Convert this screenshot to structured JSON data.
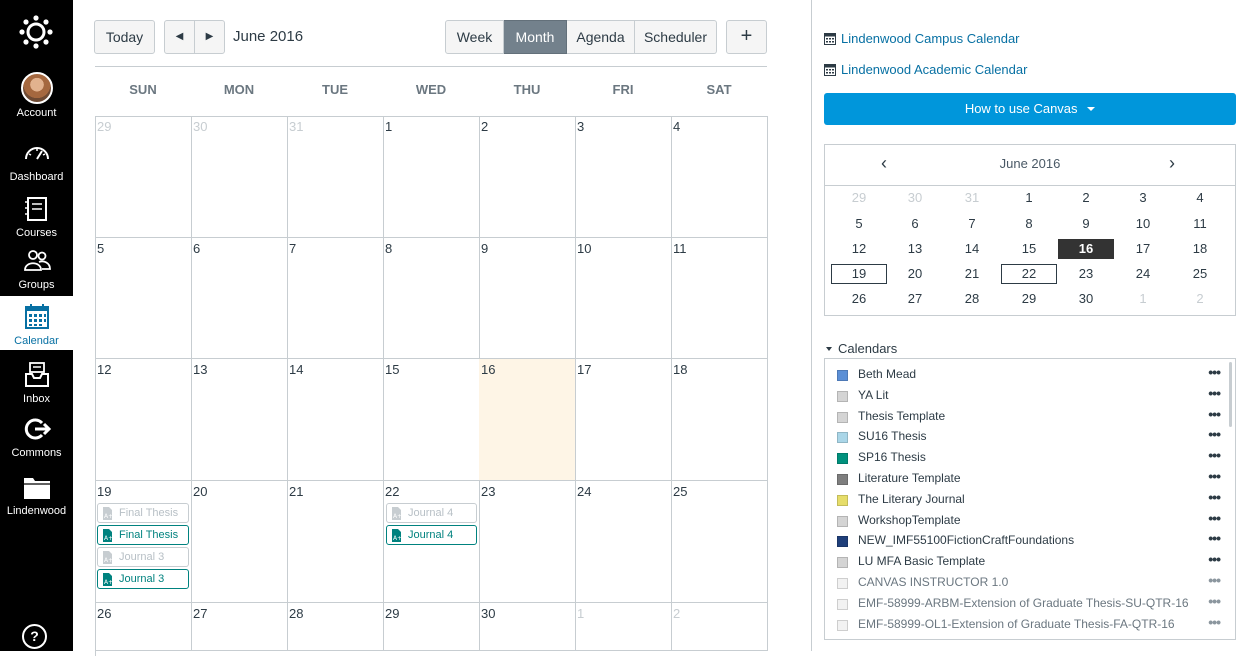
{
  "nav": {
    "items": [
      {
        "label": "Account",
        "icon": "avatar"
      },
      {
        "label": "Dashboard",
        "icon": "dashboard-icon"
      },
      {
        "label": "Courses",
        "icon": "courses-icon"
      },
      {
        "label": "Groups",
        "icon": "groups-icon"
      },
      {
        "label": "Calendar",
        "icon": "calendar-icon",
        "active": true
      },
      {
        "label": "Inbox",
        "icon": "inbox-icon"
      },
      {
        "label": "Commons",
        "icon": "commons-icon"
      },
      {
        "label": "Lindenwood",
        "icon": "folder-icon"
      }
    ],
    "help": "?"
  },
  "toolbar": {
    "today": "Today",
    "prev": "◀",
    "next": "▶",
    "title": "June 2016",
    "views": [
      "Week",
      "Month",
      "Agenda",
      "Scheduler"
    ],
    "active_view": "Month",
    "add": "+"
  },
  "calendar": {
    "weekdays": [
      "SUN",
      "MON",
      "TUE",
      "WED",
      "THU",
      "FRI",
      "SAT"
    ],
    "weeks": [
      [
        "29",
        "30",
        "31",
        "1",
        "2",
        "3",
        "4"
      ],
      [
        "5",
        "6",
        "7",
        "8",
        "9",
        "10",
        "11"
      ],
      [
        "12",
        "13",
        "14",
        "15",
        "16",
        "17",
        "18"
      ],
      [
        "19",
        "20",
        "21",
        "22",
        "23",
        "24",
        "25"
      ],
      [
        "26",
        "27",
        "28",
        "29",
        "30",
        "1",
        "2"
      ]
    ],
    "events": {
      "sun19": [
        "Final Thesis",
        "Final Thesis",
        "Journal 3",
        "Journal 3"
      ],
      "wed22": [
        "Journal 4",
        "Journal 4"
      ]
    }
  },
  "sidebar": {
    "links": [
      "Lindenwood Campus Calendar",
      "Lindenwood Academic Calendar"
    ],
    "how_button": "How to use Canvas",
    "mini": {
      "title": "June 2016",
      "prev": "‹",
      "next": "›",
      "weeks": [
        [
          "29",
          "30",
          "31",
          "1",
          "2",
          "3",
          "4"
        ],
        [
          "5",
          "6",
          "7",
          "8",
          "9",
          "10",
          "11"
        ],
        [
          "12",
          "13",
          "14",
          "15",
          "16",
          "17",
          "18"
        ],
        [
          "19",
          "20",
          "21",
          "22",
          "23",
          "24",
          "25"
        ],
        [
          "26",
          "27",
          "28",
          "29",
          "30",
          "1",
          "2"
        ]
      ]
    },
    "calendars_title": "Calendars",
    "calendars": [
      {
        "name": "Beth Mead",
        "color": "#5b8fd6"
      },
      {
        "name": "YA Lit",
        "color": "#d4d4d4"
      },
      {
        "name": "Thesis Template",
        "color": "#d4d4d4"
      },
      {
        "name": "SU16 Thesis",
        "color": "#aad6e8"
      },
      {
        "name": "SP16 Thesis",
        "color": "#00917d"
      },
      {
        "name": "Literature Template",
        "color": "#7e7e7e"
      },
      {
        "name": "The Literary Journal",
        "color": "#e6dd6a"
      },
      {
        "name": "WorkshopTemplate",
        "color": "#d4d4d4"
      },
      {
        "name": "NEW_IMF55100FictionCraftFoundations",
        "color": "#1f3f7a"
      },
      {
        "name": "LU MFA Basic Template",
        "color": "#d4d4d4"
      },
      {
        "name": "CANVAS INSTRUCTOR 1.0",
        "color": "#f2f2f2"
      },
      {
        "name": "EMF-58999-ARBM-Extension of Graduate Thesis-SU-QTR-16",
        "color": "#f2f2f2"
      },
      {
        "name": "EMF-58999-OL1-Extension of Graduate Thesis-FA-QTR-16",
        "color": "#f2f2f2"
      }
    ],
    "more": "•••"
  }
}
